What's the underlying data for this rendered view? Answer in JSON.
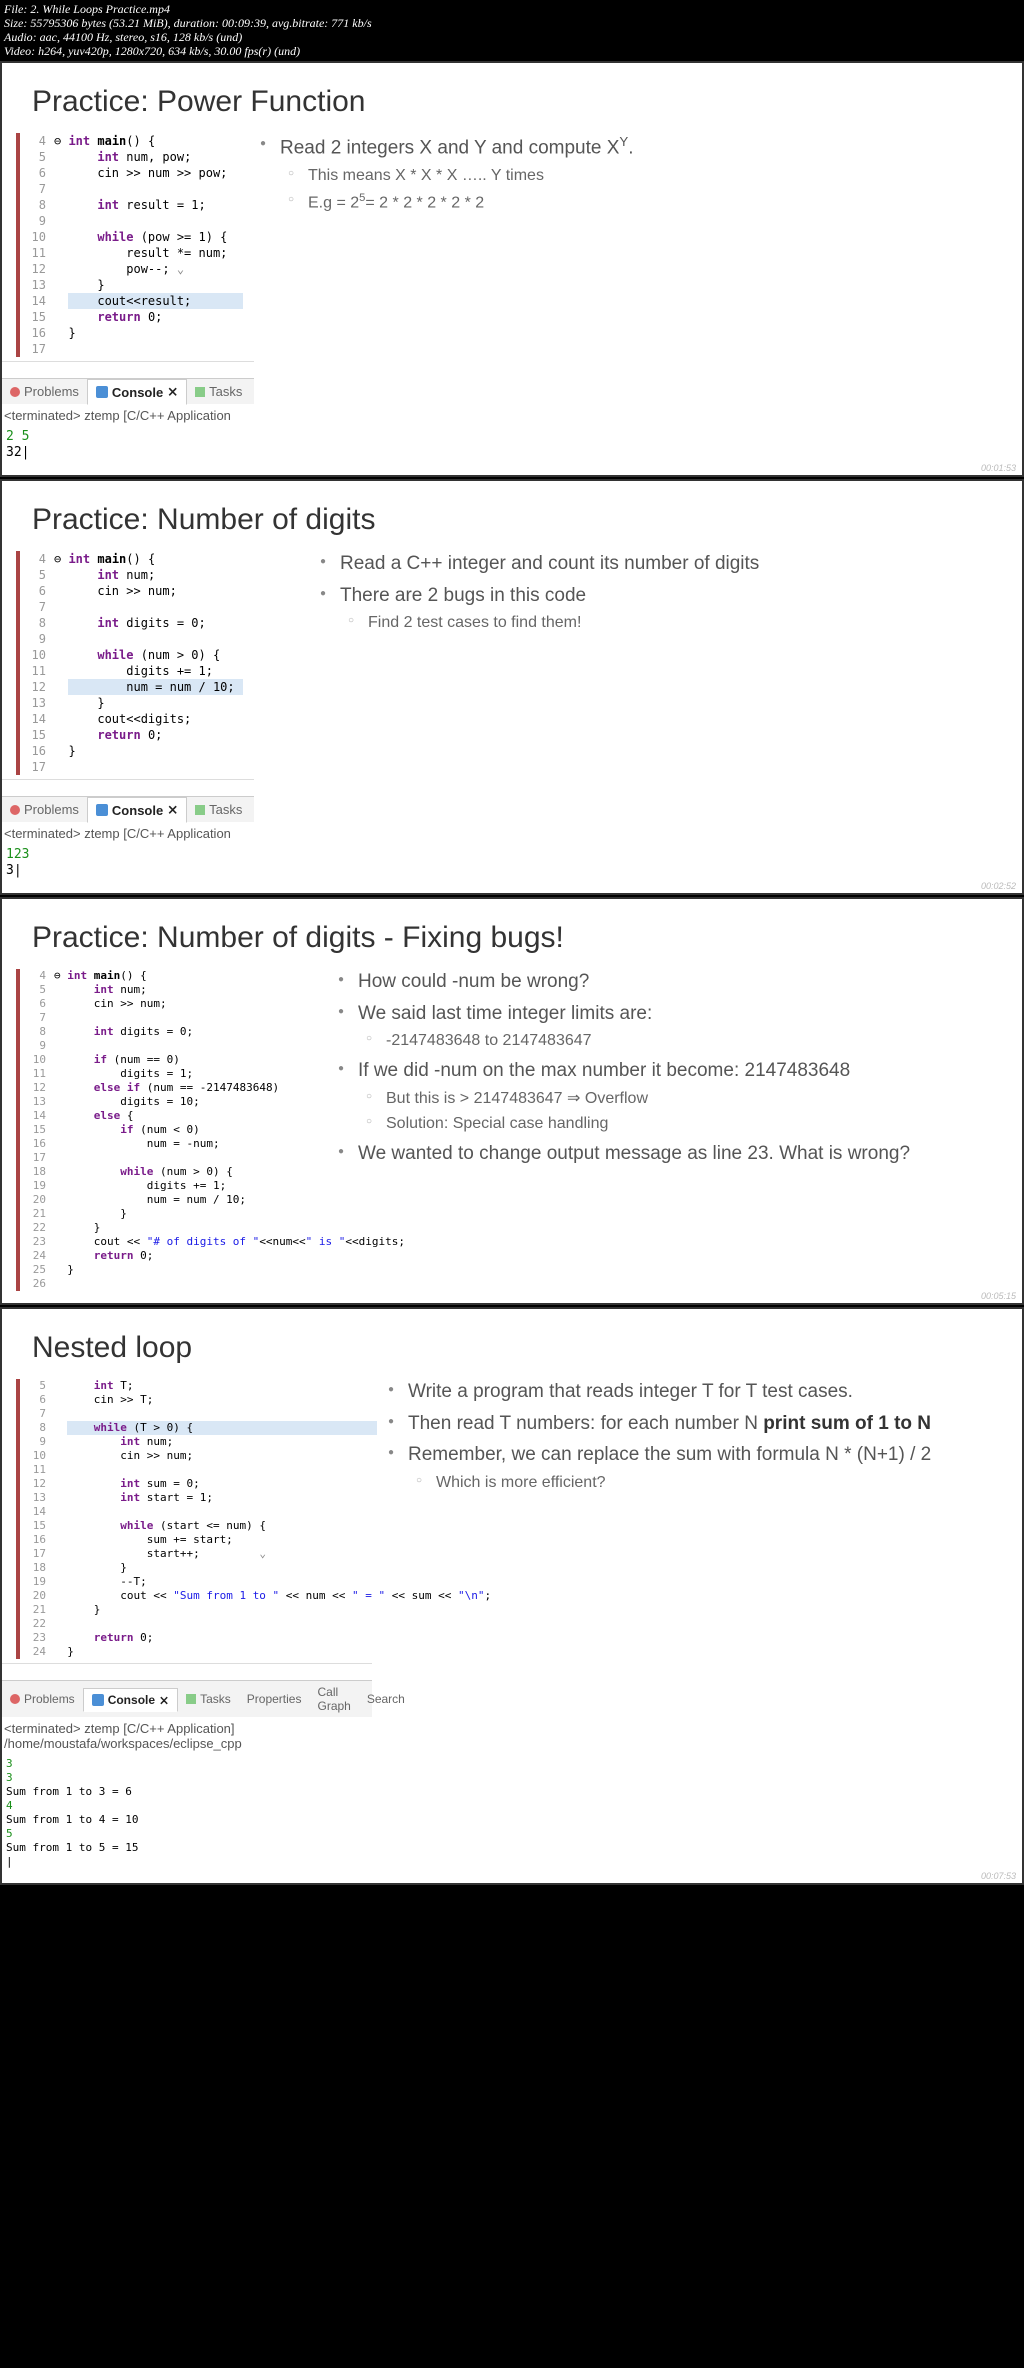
{
  "header": {
    "file": "File: 2. While Loops Practice.mp4",
    "size": "Size: 55795306 bytes (53.21 MiB), duration: 00:09:39, avg.bitrate: 771 kb/s",
    "audio": "Audio: aac, 44100 Hz, stereo, s16, 128 kb/s (und)",
    "video": "Video: h264, yuv420p, 1280x720, 634 kb/s, 30.00 fps(r) (und)"
  },
  "tabs": {
    "problems": "Problems",
    "console": "Console",
    "tasks": "Tasks",
    "properties": "Properties",
    "callgraph": "Call Graph",
    "search": "Search"
  },
  "slide1": {
    "title": "Practice: Power Function",
    "code": {
      "l4": "int main() {",
      "l5": "    int num, pow;",
      "l6": "    cin >> num >> pow;",
      "l8": "    int result = 1;",
      "l10": "    while (pow >= 1) {",
      "l11": "        result *= num;",
      "l12": "        pow--;",
      "l13": "    }",
      "l14": "    cout<<result;",
      "l15": "    return 0;",
      "l16": "}"
    },
    "term": "<terminated> ztemp [C/C++ Application",
    "out_in": "2 5",
    "out_val": "32",
    "b1_pre": "Read 2 integers X and Y and compute X",
    "b1_sup": "Y",
    "b1_post": ".",
    "s1": "This means X * X * X ….. Y times",
    "s2_pre": "E.g = 2",
    "s2_sup": "5",
    "s2_post": "= 2 * 2 * 2 * 2 * 2",
    "ts": "00:01:53"
  },
  "slide2": {
    "title": "Practice: Number of digits",
    "code": {
      "l4": "int main() {",
      "l5": "    int num;",
      "l6": "    cin >> num;",
      "l8": "    int digits = 0;",
      "l10": "    while (num > 0) {",
      "l11": "        digits += 1;",
      "l12": "        num = num / 10;",
      "l13": "    }",
      "l14": "    cout<<digits;",
      "l15": "    return 0;",
      "l16": "}"
    },
    "term": "<terminated> ztemp [C/C++ Application",
    "out_in": "123",
    "out_val": "3",
    "b1": "Read a C++ integer and count its number of digits",
    "b2": "There are 2 bugs in this code",
    "s1": "Find 2 test cases to find them!",
    "ts": "00:02:52"
  },
  "slide3": {
    "title": "Practice: Number of digits - Fixing bugs!",
    "code": {
      "l4": "int main() {",
      "l5": "    int num;",
      "l6": "    cin >> num;",
      "l8": "    int digits = 0;",
      "l10": "    if (num == 0)",
      "l11": "        digits = 1;",
      "l12": "    else if (num == -2147483648)",
      "l13": "        digits = 10;",
      "l14": "    else {",
      "l15": "        if (num < 0)",
      "l16": "            num = -num;",
      "l18": "        while (num > 0) {",
      "l19": "            digits += 1;",
      "l20": "            num = num / 10;",
      "l21": "        }",
      "l22": "    }",
      "l23": "    cout << \"# of digits of \"<<num<<\" is \"<<digits;",
      "l24": "    return 0;",
      "l25": "}"
    },
    "b1": "How could -num be wrong?",
    "b2": "We said last time integer limits are:",
    "s2": "-2147483648 to 2147483647",
    "b3": "If we did -num on the max number it become: 2147483648",
    "s3a": "But this is > 2147483647 ⇒ Overflow",
    "s3b": "Solution: Special case handling",
    "b4": "We wanted to change output message as line 23. What is wrong?",
    "ts": "00:05:15"
  },
  "slide4": {
    "title": "Nested loop",
    "code": {
      "l5": "    int T;",
      "l6": "    cin >> T;",
      "l8": "    while (T > 0) {",
      "l9": "        int num;",
      "l10": "        cin >> num;",
      "l12": "        int sum = 0;",
      "l13": "        int start = 1;",
      "l15": "        while (start <= num) {",
      "l16": "            sum += start;",
      "l17": "            start++;",
      "l18": "        }",
      "l19": "        --T;",
      "l20a": "        cout << ",
      "l20s1": "\"Sum from 1 to \"",
      "l20b": " << num << ",
      "l20s2": "\" = \"",
      "l20c": " << sum << ",
      "l20s3": "\"\\n\"",
      "l20d": ";",
      "l21": "    }",
      "l23": "    return 0;",
      "l24": "}"
    },
    "term": "<terminated> ztemp [C/C++ Application] /home/moustafa/workspaces/eclipse_cpp",
    "out": {
      "i1": "3",
      "i2": "3",
      "o1": "Sum from 1 to 3 = 6",
      "i3": "4",
      "o2": "Sum from 1 to 4 = 10",
      "i4": "5",
      "o3": "Sum from 1 to 5 = 15"
    },
    "b1": "Write a program that reads integer T for T test cases.",
    "b2_pre": "Then read T numbers: for each number N ",
    "b2_b": "print sum of 1 to N",
    "b3": "Remember, we can replace the sum with formula N * (N+1) / 2",
    "s1": "Which is more efficient?",
    "ts": "00:07:53"
  },
  "chart_data": null
}
